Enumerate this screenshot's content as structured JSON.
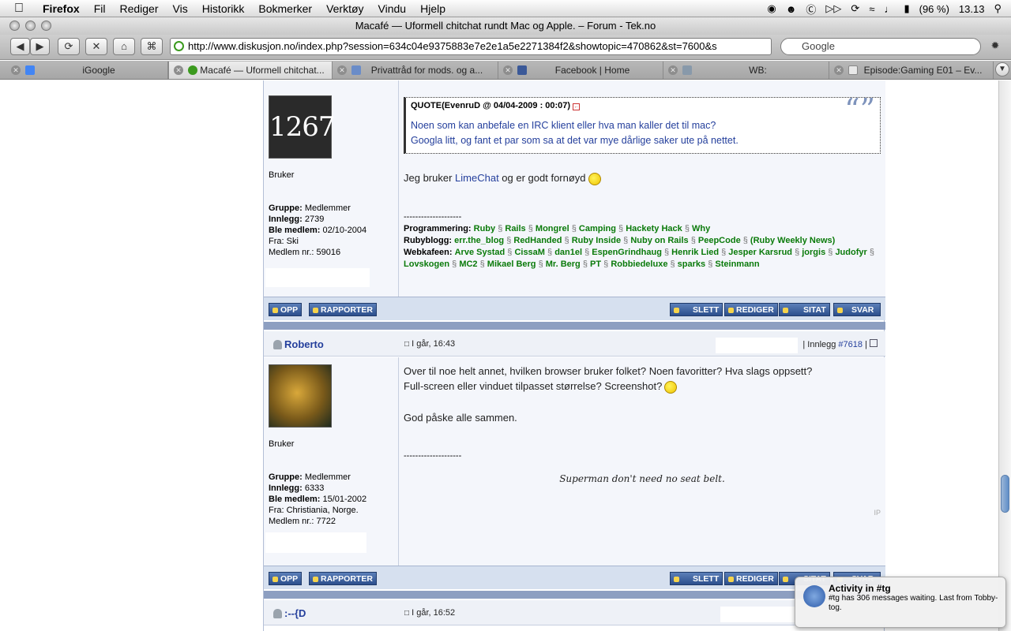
{
  "menubar": {
    "app_name": "Firefox",
    "menus": [
      "Fil",
      "Rediger",
      "Vis",
      "Historikk",
      "Bokmerker",
      "Verktøy",
      "Vindu",
      "Hjelp"
    ],
    "battery": "(96 %)",
    "clock": "13.13"
  },
  "window": {
    "title": "Macafé — Uformell chitchat rundt Mac og Apple. – Forum - Tek.no"
  },
  "navbar": {
    "url": "http://www.diskusjon.no/index.php?session=634c04e9375883e7e2e1a5e2271384f2&showtopic=470862&st=7600&s",
    "search_placeholder": "Google"
  },
  "tabs": [
    {
      "label": "iGoogle"
    },
    {
      "label": "Macafé — Uformell chitchat..."
    },
    {
      "label": "Privattråd for mods. og a..."
    },
    {
      "label": "Facebook | Home"
    },
    {
      "label": "WB:"
    },
    {
      "label": "Episode:Gaming E01 – Ev..."
    }
  ],
  "post1": {
    "avatar_text": "1267",
    "rank": "Bruker",
    "group_label": "Gruppe:",
    "group": "Medlemmer",
    "posts_label": "Innlegg:",
    "posts": "2739",
    "joined_label": "Ble medlem:",
    "joined": "02/10-2004",
    "from": "Fra: Ski",
    "member_no": "Medlem nr.: 59016",
    "quote_header": "QUOTE(EvenruD @ 04/04-2009 : 00:07)",
    "quote_line1": "Noen som kan anbefale en IRC klient eller hva man kaller det til mac?",
    "quote_line2": "Googla litt, og fant et par som sa at det var mye dårlige saker ute på nettet.",
    "text_before": "Jeg bruker ",
    "text_link": "LimeChat",
    "text_after": " og er godt fornøyd",
    "sig_rule": "--------------------",
    "sig_prog_label": "Programmering:",
    "sig_prog": [
      "Ruby",
      "Rails",
      "Mongrel",
      "Camping",
      "Hackety Hack",
      "Why"
    ],
    "sig_ruby_label": "Rubyblogg:",
    "sig_ruby": [
      "err.the_blog",
      "RedHanded",
      "Ruby Inside",
      "Nuby on Rails",
      "PeepCode",
      "(Ruby Weekly News)"
    ],
    "sig_web_label": "Webkafeen:",
    "sig_web": [
      "Arve Systad",
      "CissaM",
      "dan1el",
      "EspenGrindhaug",
      "Henrik Lied",
      "Jesper Karsrud",
      "jorgis",
      "Judofyr",
      "Lovskogen",
      "MC2",
      "Mikael Berg",
      "Mr. Berg",
      "PT",
      "Robbiedeluxe",
      "sparks",
      "Steinmann"
    ]
  },
  "buttons": {
    "up": "OPP",
    "report": "RAPPORTER",
    "delete": "SLETT",
    "edit": "REDIGER",
    "quote": "SITAT",
    "reply": "SVAR"
  },
  "post2": {
    "author": "Roberto",
    "date": "I går, 16:43",
    "post_no_prefix": "| Innlegg ",
    "post_no": "#7618",
    "post_no_suffix": " |",
    "rank": "Bruker",
    "group_label": "Gruppe:",
    "group": "Medlemmer",
    "posts_label": "Innlegg:",
    "posts": "6333",
    "joined_label": "Ble medlem:",
    "joined": "15/01-2002",
    "from": "Fra: Christiania, Norge.",
    "member_no": "Medlem nr.: 7722",
    "line1": "Over til noe helt annet, hvilken browser bruker folket? Noen favoritter? Hva slags oppsett?",
    "line2": "Full-screen eller vinduet tilpasset størrelse? Screenshot?",
    "line3": "God påske alle sammen.",
    "sig_rule": "--------------------",
    "signature": "Superman don't need no seat belt."
  },
  "post3": {
    "author": ":--{D",
    "date": "I går, 16:52"
  },
  "growl": {
    "title": "Activity in #tg",
    "body": "#tg has 306 messages waiting. Last from Tobby-tog."
  }
}
